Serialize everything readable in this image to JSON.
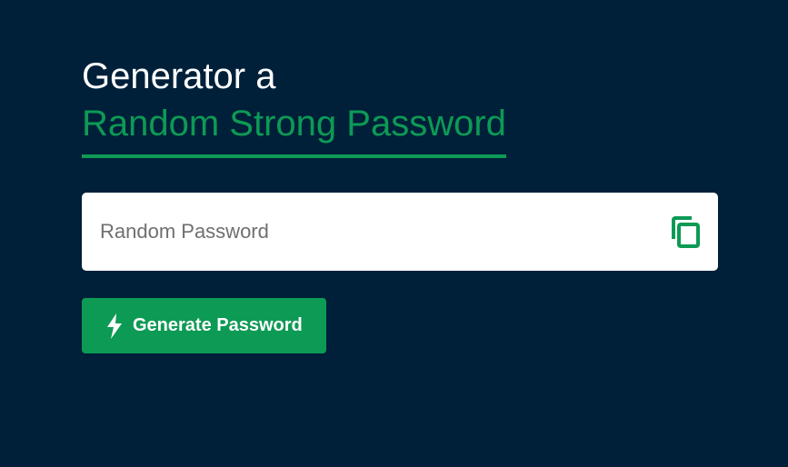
{
  "heading": {
    "line1": "Generator a",
    "line2": "Random Strong Password"
  },
  "password_field": {
    "value": "",
    "placeholder": "Random Password",
    "copy_icon": "copy-icon"
  },
  "generate_button": {
    "label": "Generate Password",
    "icon": "lightning-bolt-icon"
  },
  "colors": {
    "background": "#002039",
    "accent": "#0d9a55",
    "heading_text": "#ffffff",
    "field_background": "#ffffff"
  }
}
